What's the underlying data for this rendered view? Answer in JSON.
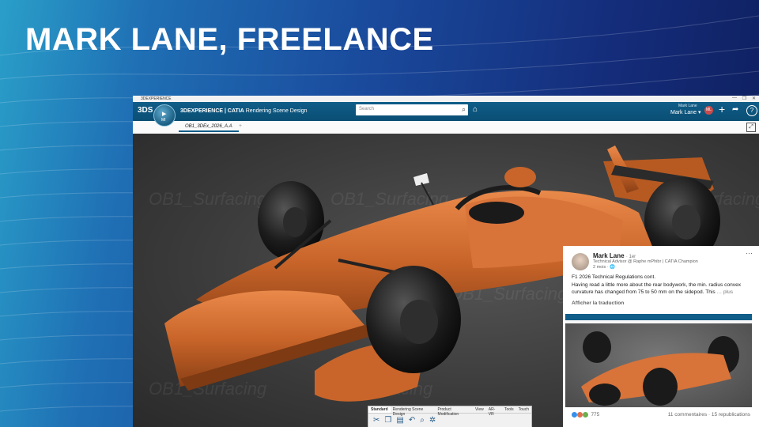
{
  "slide": {
    "title": "MARK LANE, FREELANCE"
  },
  "app": {
    "window_title": "3DEXPERIENCE",
    "window_controls": [
      "—",
      "❐",
      "✕"
    ],
    "ds_logo": "3DS",
    "compass_label": "MI",
    "brand_prefix": "3DEXPERIENCE | CATIA",
    "brand_suffix": "Rendering Scene Design",
    "search_placeholder": "Search",
    "user_small": "Mark Lane",
    "user_name": "Mark Lane ▾",
    "avatar_initials": "ML",
    "help_label": "?",
    "tab_label": "OB1_3DEx_2026_A.A",
    "tab_add": "+",
    "watermark": "OB1_Surfacing",
    "toolbar_tabs": [
      "Standard",
      "Rendering Scene Design",
      "Product Modification",
      "View",
      "AR-VR",
      "Tools",
      "Touch"
    ]
  },
  "linkedin": {
    "name": "Mark Lane",
    "degree": "· 1er",
    "headline": "Technical Advisor @ Raphe mPhibr | CATIA Champion",
    "time": "2 mois · 🌐",
    "line1": "F1 2026 Technical Regulations cont.",
    "line2": "Having read a little more about the rear bodywork, the min. radius convex curvature has changed from 75 to 50 mm on the sidepod. This",
    "more": "… plus",
    "translate": "Afficher la traduction",
    "reactions_count": "775",
    "comments": "11 commentaires · 15 republications"
  }
}
